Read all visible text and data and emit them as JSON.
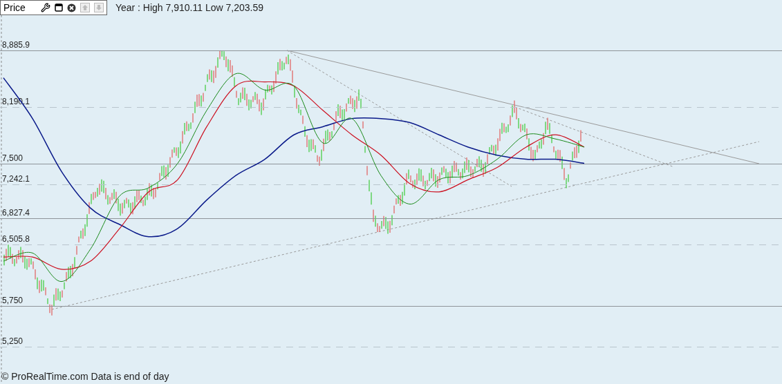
{
  "panel": {
    "title": "Price",
    "summary": "Year : High 7,910.11 Low 7,203.59"
  },
  "gridlines": [
    {
      "kind": "solid"
    },
    {
      "kind": "dashed"
    },
    {
      "kind": "solid"
    },
    {
      "kind": "dashed"
    },
    {
      "kind": "solid"
    },
    {
      "kind": "dashed"
    },
    {
      "kind": "solid"
    },
    {
      "kind": "dashed"
    }
  ],
  "chart_data": {
    "type": "line",
    "grid": true,
    "ylim": [
      4792.3,
      9504.6
    ],
    "yticks": [
      {
        "value": 8885.9,
        "label": "8,885.9"
      },
      {
        "value": 8190.1,
        "label": "8,190.1"
      },
      {
        "value": 7500,
        "label": "7,500"
      },
      {
        "value": 7242.1,
        "label": "7,242.1"
      },
      {
        "value": 6827.4,
        "label": "6,827.4"
      },
      {
        "value": 6505.8,
        "label": "6,505.8"
      },
      {
        "value": 5750,
        "label": "5,750"
      },
      {
        "value": 5250,
        "label": "5,250"
      }
    ],
    "series": [
      {
        "color": "#0a1a8a",
        "values": [
          8550,
          8050,
          7400,
          6950,
          6750,
          6600,
          6700,
          7050,
          7350,
          7550,
          7850,
          7950,
          8050,
          8050,
          8000,
          7850,
          7700,
          7600,
          7550,
          7550,
          7500
        ]
      },
      {
        "color": "#cc1020",
        "values": [
          6350,
          6350,
          6200,
          6300,
          6700,
          7150,
          7300,
          7950,
          8450,
          8500,
          8450,
          8150,
          7850,
          7600,
          7250,
          7150,
          7300,
          7450,
          7700,
          7850,
          7700
        ]
      },
      {
        "color": "#1a8a1a",
        "values": [
          6300,
          6400,
          6050,
          6450,
          7100,
          7200,
          7500,
          8150,
          8600,
          8400,
          8450,
          7750,
          8050,
          7350,
          7000,
          7300,
          7350,
          7550,
          7850,
          7800,
          7700
        ]
      }
    ]
  },
  "footer": "© ProRealTime.com Data is end of day"
}
